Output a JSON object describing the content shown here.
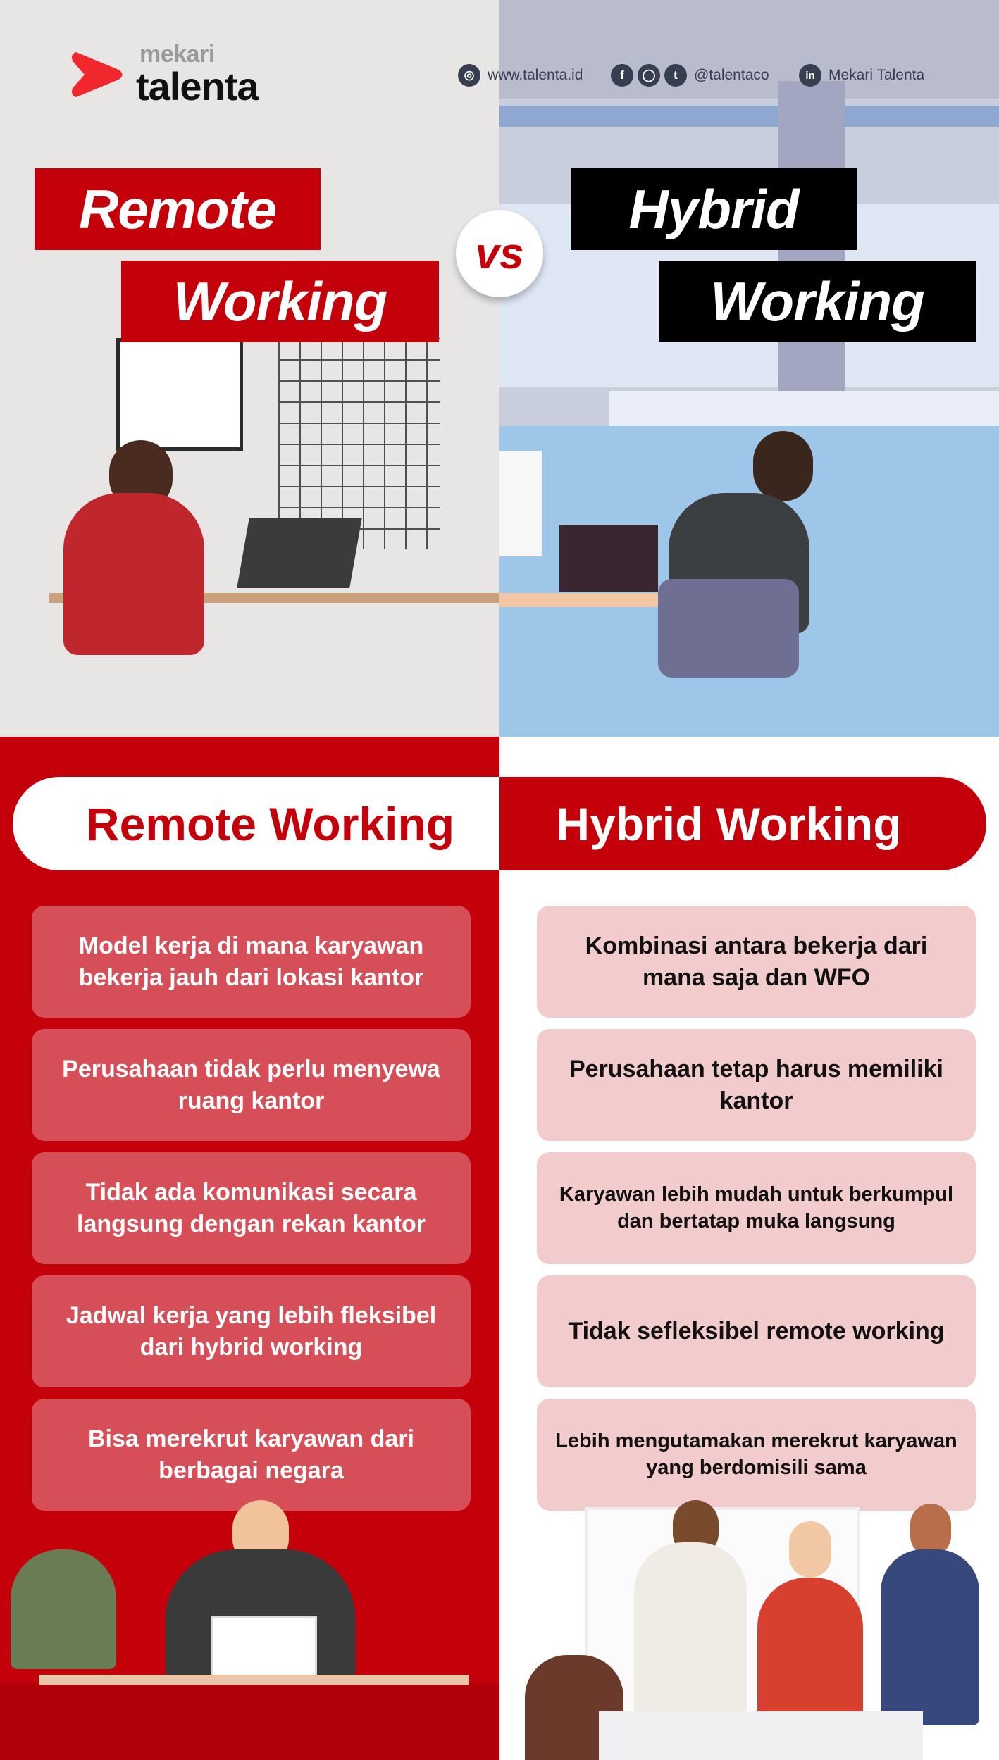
{
  "brand": {
    "parent": "mekari",
    "product": "talenta",
    "logo_icon": "chevron-right-logo-icon",
    "accent_color": "#c4000b",
    "logo_color": "#f0282d"
  },
  "social_bar": {
    "website": {
      "icon": "globe-icon",
      "text": "www.talenta.id"
    },
    "social_handle": {
      "icons": [
        "facebook-icon",
        "instagram-icon",
        "twitter-icon"
      ],
      "text": "@talentaco"
    },
    "linkedin": {
      "icon": "linkedin-icon",
      "text": "Mekari Talenta"
    }
  },
  "hero": {
    "left_title_line1": "Remote",
    "left_title_line2": "Working",
    "vs_label": "vs",
    "right_title_line1": "Hybrid",
    "right_title_line2": "Working"
  },
  "comparison": {
    "remote": {
      "header": "Remote Working",
      "points": [
        "Model kerja di mana karyawan bekerja jauh dari lokasi kantor",
        "Perusahaan tidak perlu menyewa ruang kantor",
        "Tidak ada komunikasi secara langsung dengan rekan kantor",
        "Jadwal kerja yang lebih fleksibel dari hybrid working",
        "Bisa merekrut karyawan dari berbagai negara"
      ]
    },
    "hybrid": {
      "header": "Hybrid Working",
      "points": [
        "Kombinasi antara bekerja dari mana saja dan WFO",
        "Perusahaan tetap harus memiliki kantor",
        "Karyawan lebih mudah untuk berkumpul dan bertatap muka langsung",
        "Tidak sefleksibel remote working",
        "Lebih mengutamakan merekrut karyawan yang berdomisili sama"
      ]
    }
  },
  "illustrations": {
    "top_left": "person-working-at-home-desk-illustration",
    "top_right": "person-working-in-office-illustration",
    "bottom_left": "woman-meditating-at-desk-illustration",
    "bottom_right": "team-meeting-illustration"
  }
}
